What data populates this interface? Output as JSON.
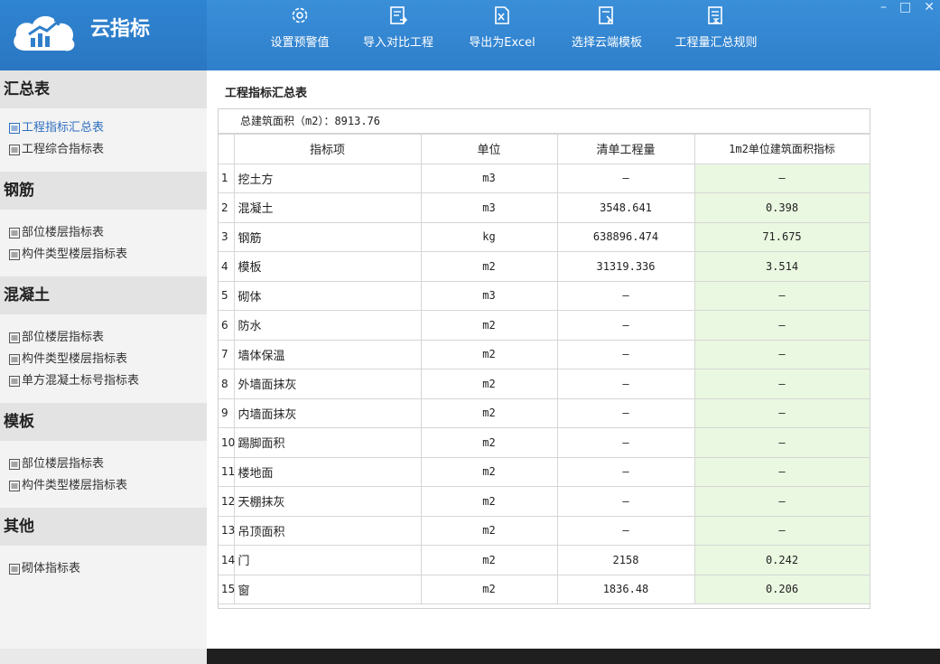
{
  "app": {
    "title": "云指标"
  },
  "toolbar": [
    {
      "label": "设置预警值",
      "icon": "gear-icon"
    },
    {
      "label": "导入对比工程",
      "icon": "import-icon"
    },
    {
      "label": "导出为Excel",
      "icon": "export-excel-icon"
    },
    {
      "label": "选择云端模板",
      "icon": "cloud-template-icon"
    },
    {
      "label": "工程量汇总规则",
      "icon": "rules-icon"
    }
  ],
  "window": {
    "minimize": "–",
    "maximize": "□",
    "close": "✕"
  },
  "sidebar": {
    "groups": [
      {
        "title": "汇总表",
        "items": [
          "工程指标汇总表",
          "工程综合指标表"
        ]
      },
      {
        "title": "钢筋",
        "items": [
          "部位楼层指标表",
          "构件类型楼层指标表"
        ]
      },
      {
        "title": "混凝土",
        "items": [
          "部位楼层指标表",
          "构件类型楼层指标表",
          "单方混凝土标号指标表"
        ]
      },
      {
        "title": "模板",
        "items": [
          "部位楼层指标表",
          "构件类型楼层指标表"
        ]
      },
      {
        "title": "其他",
        "items": [
          "砌体指标表"
        ]
      }
    ]
  },
  "main": {
    "title": "工程指标汇总表",
    "total": "总建筑面积（m2）：8913.76",
    "columns": [
      "指标项",
      "单位",
      "清单工程量",
      "1m2单位建筑面积指标"
    ],
    "rows": [
      {
        "n": "1",
        "name": "挖土方",
        "unit": "m3",
        "qty": "–",
        "idx": "–"
      },
      {
        "n": "2",
        "name": "混凝土",
        "unit": "m3",
        "qty": "3548.641",
        "idx": "0.398"
      },
      {
        "n": "3",
        "name": "钢筋",
        "unit": "kg",
        "qty": "638896.474",
        "idx": "71.675"
      },
      {
        "n": "4",
        "name": "模板",
        "unit": "m2",
        "qty": "31319.336",
        "idx": "3.514"
      },
      {
        "n": "5",
        "name": "砌体",
        "unit": "m3",
        "qty": "–",
        "idx": "–"
      },
      {
        "n": "6",
        "name": "防水",
        "unit": "m2",
        "qty": "–",
        "idx": "–"
      },
      {
        "n": "7",
        "name": "墙体保温",
        "unit": "m2",
        "qty": "–",
        "idx": "–"
      },
      {
        "n": "8",
        "name": "外墙面抹灰",
        "unit": "m2",
        "qty": "–",
        "idx": "–"
      },
      {
        "n": "9",
        "name": "内墙面抹灰",
        "unit": "m2",
        "qty": "–",
        "idx": "–"
      },
      {
        "n": "10",
        "name": "踢脚面积",
        "unit": "m2",
        "qty": "–",
        "idx": "–"
      },
      {
        "n": "11",
        "name": "楼地面",
        "unit": "m2",
        "qty": "–",
        "idx": "–"
      },
      {
        "n": "12",
        "name": "天棚抹灰",
        "unit": "m2",
        "qty": "–",
        "idx": "–"
      },
      {
        "n": "13",
        "name": "吊顶面积",
        "unit": "m2",
        "qty": "–",
        "idx": "–"
      },
      {
        "n": "14",
        "name": "门",
        "unit": "m2",
        "qty": "2158",
        "idx": "0.242"
      },
      {
        "n": "15",
        "name": "窗",
        "unit": "m2",
        "qty": "1836.48",
        "idx": "0.206"
      }
    ]
  },
  "colors": {
    "accent": "#2f7fcb",
    "highlight_col": "#eaf8e1",
    "active_link": "#2f6fc0"
  }
}
